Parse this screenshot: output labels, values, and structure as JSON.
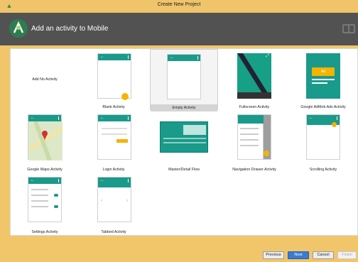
{
  "window": {
    "title": "Create New Project"
  },
  "header": {
    "title": "Add an activity to Mobile"
  },
  "activities": [
    {
      "label": "Add No Activity"
    },
    {
      "label": "Blank Activity"
    },
    {
      "label": "Empty Activity",
      "selected": true
    },
    {
      "label": "Fullscreen Activity"
    },
    {
      "label": "Google AdMob Ads Activity",
      "ad_badge": "Ad"
    },
    {
      "label": "Google Maps Activity"
    },
    {
      "label": "Login Activity"
    },
    {
      "label": "Master/Detail Flow"
    },
    {
      "label": "Navigation Drawer Activity"
    },
    {
      "label": "Scrolling Activity"
    },
    {
      "label": "Settings Activity"
    },
    {
      "label": "Tabbed Activity"
    }
  ],
  "buttons": {
    "previous": "Previous",
    "next": "Next",
    "cancel": "Cancel",
    "finish": "Finish"
  },
  "colors": {
    "accent": "#1a9a8a",
    "fab": "#f4b400",
    "header": "#525252",
    "frame": "#f1c66a"
  }
}
